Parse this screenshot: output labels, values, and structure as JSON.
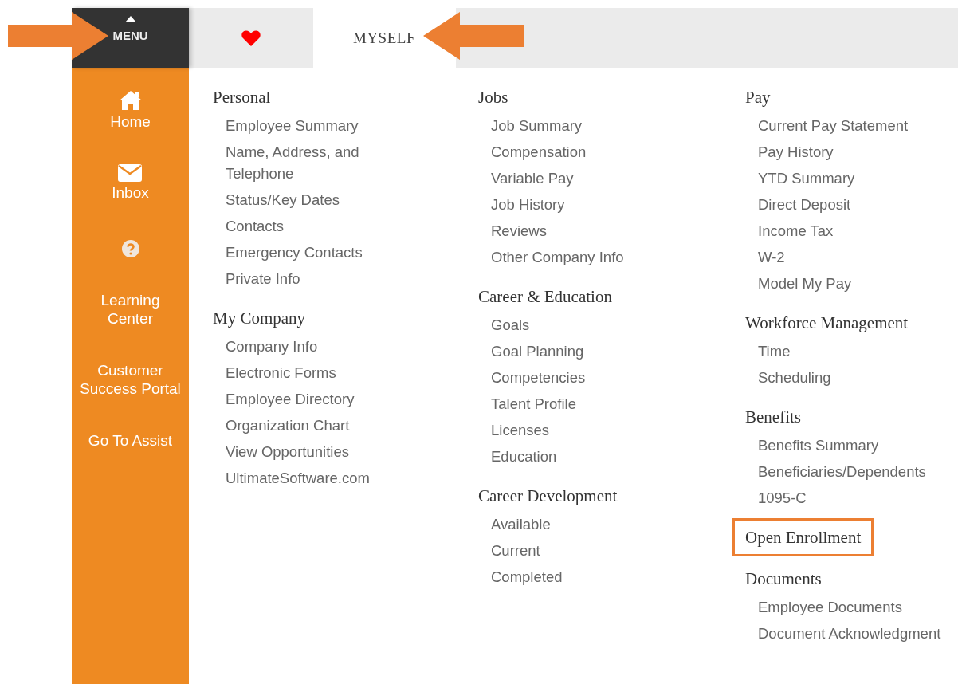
{
  "menu_button": {
    "label": "MENU"
  },
  "tabs": [
    {
      "kind": "favorites",
      "selected": false
    },
    {
      "kind": "text",
      "label": "MYSELF",
      "selected": true
    }
  ],
  "sidebar": {
    "items": [
      {
        "kind": "home",
        "label": "Home"
      },
      {
        "kind": "inbox",
        "label": "Inbox"
      },
      {
        "kind": "help"
      },
      {
        "kind": "text",
        "label": "Learning Center"
      },
      {
        "kind": "text",
        "label": "Customer Success Portal"
      },
      {
        "kind": "text",
        "label": "Go To Assist"
      }
    ]
  },
  "columns": [
    [
      {
        "heading": "Personal",
        "highlighted": false,
        "items": [
          "Employee Summary",
          "Name, Address, and Telephone",
          "Status/Key Dates",
          "Contacts",
          "Emergency Contacts",
          "Private Info"
        ]
      },
      {
        "heading": "My Company",
        "highlighted": false,
        "items": [
          "Company Info",
          "Electronic Forms",
          "Employee Directory",
          "Organization Chart",
          "View Opportunities",
          "UltimateSoftware.com"
        ]
      }
    ],
    [
      {
        "heading": "Jobs",
        "highlighted": false,
        "items": [
          "Job Summary",
          "Compensation",
          "Variable Pay",
          "Job History",
          "Reviews",
          "Other Company Info"
        ]
      },
      {
        "heading": "Career & Education",
        "highlighted": false,
        "items": [
          "Goals",
          "Goal Planning",
          "Competencies",
          "Talent Profile",
          "Licenses",
          "Education"
        ]
      },
      {
        "heading": "Career Development",
        "highlighted": false,
        "items": [
          "Available",
          "Current",
          "Completed"
        ]
      }
    ],
    [
      {
        "heading": "Pay",
        "highlighted": false,
        "items": [
          "Current Pay Statement",
          "Pay History",
          "YTD Summary",
          "Direct Deposit",
          "Income Tax",
          "W-2",
          "Model My Pay"
        ]
      },
      {
        "heading": "Workforce Management",
        "highlighted": false,
        "items": [
          "Time",
          "Scheduling"
        ]
      },
      {
        "heading": "Benefits",
        "highlighted": false,
        "items": [
          "Benefits Summary",
          "Beneficiaries/Dependents",
          "1095-C"
        ]
      },
      {
        "heading": "Open Enrollment",
        "highlighted": true
      },
      {
        "heading": "Documents",
        "highlighted": false,
        "items": [
          "Employee Documents",
          "Document Acknowledgment"
        ]
      }
    ]
  ],
  "callouts": [
    {
      "kind": "arrow-right"
    },
    {
      "kind": "arrow-left"
    }
  ]
}
